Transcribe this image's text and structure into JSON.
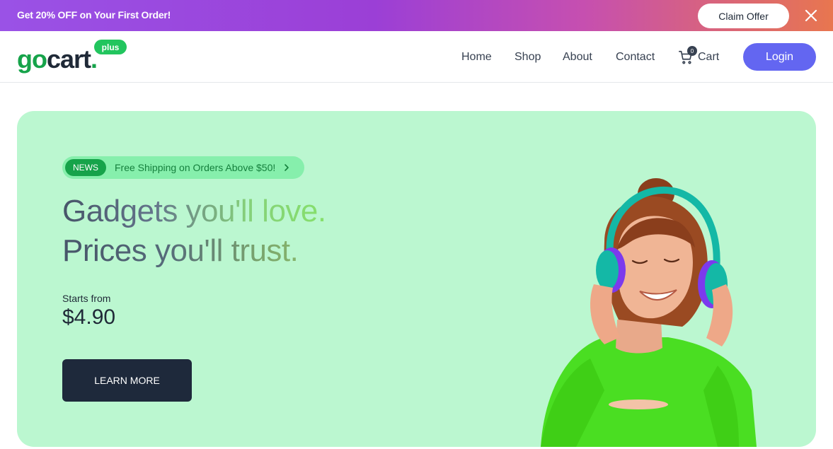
{
  "promo": {
    "text": "Get 20% OFF on Your First Order!",
    "claim_label": "Claim Offer",
    "close_icon": "close-icon"
  },
  "header": {
    "logo": {
      "go": "go",
      "cart": "cart",
      "dot": ".",
      "badge": "plus"
    },
    "nav": [
      {
        "label": "Home"
      },
      {
        "label": "Shop"
      },
      {
        "label": "About"
      },
      {
        "label": "Contact"
      }
    ],
    "cart": {
      "label": "Cart",
      "count": "0",
      "icon": "cart-icon"
    },
    "login_label": "Login"
  },
  "hero": {
    "news_tag": "NEWS",
    "news_text": "Free Shipping on Orders Above $50!",
    "headline_line1": "Gadgets you'll love.",
    "headline_line2": "Prices you'll trust.",
    "starts_label": "Starts from",
    "price": "$4.90",
    "cta_label": "LEARN MORE",
    "image": "woman-with-headphones-image"
  },
  "colors": {
    "brand_green": "#16a34a",
    "accent_indigo": "#6366f1",
    "hero_bg": "#bbf7d0",
    "cta_dark": "#1e293b"
  }
}
